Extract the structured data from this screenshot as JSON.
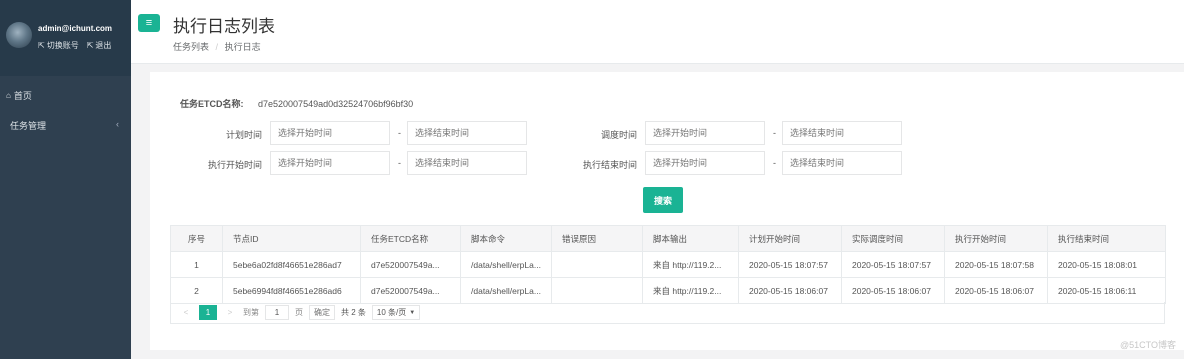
{
  "sidebar": {
    "user": "admin@ichunt.com",
    "switch_account": "切换账号",
    "logout": "退出",
    "items": [
      {
        "label": "首页"
      },
      {
        "label": "任务管理"
      }
    ]
  },
  "header": {
    "title": "执行日志列表",
    "breadcrumb": [
      "任务列表",
      "执行日志"
    ]
  },
  "form": {
    "etcd_label": "任务ETCD名称:",
    "etcd_value": "d7e520007549ad0d32524706bf96bf30",
    "plan_time_label": "计划时间",
    "dispatch_time_label": "调度时间",
    "exec_start_label": "执行开始时间",
    "exec_end_label": "执行结束时间",
    "start_placeholder": "选择开始时间",
    "end_placeholder": "选择结束时间",
    "dash": "-",
    "search_label": "搜索"
  },
  "table": {
    "headers": [
      "序号",
      "节点ID",
      "任务ETCD名称",
      "脚本命令",
      "错误原因",
      "脚本输出",
      "计划开始时间",
      "实际调度时间",
      "执行开始时间",
      "执行结束时间"
    ],
    "rows": [
      [
        "1",
        "5ebe6a02fd8f46651e286ad7",
        "d7e520007549a...",
        "/data/shell/erpLa...",
        "",
        "来自 http://119.2...",
        "2020-05-15 18:07:57",
        "2020-05-15 18:07:57",
        "2020-05-15 18:07:58",
        "2020-05-15 18:08:01"
      ],
      [
        "2",
        "5ebe6994fd8f46651e286ad6",
        "d7e520007549a...",
        "/data/shell/erpLa...",
        "",
        "来自 http://119.2...",
        "2020-05-15 18:06:07",
        "2020-05-15 18:06:07",
        "2020-05-15 18:06:07",
        "2020-05-15 18:06:11"
      ]
    ]
  },
  "pager": {
    "prev": "<",
    "current": "1",
    "next": ">",
    "goto": "到第",
    "page_input": "1",
    "page_unit": "页",
    "confirm": "确定",
    "total": "共 2 条",
    "page_size": "10 条/页"
  },
  "watermark": "@51CTO博客",
  "colors": {
    "accent": "#1ab394",
    "sidebar": "#2f4050"
  }
}
